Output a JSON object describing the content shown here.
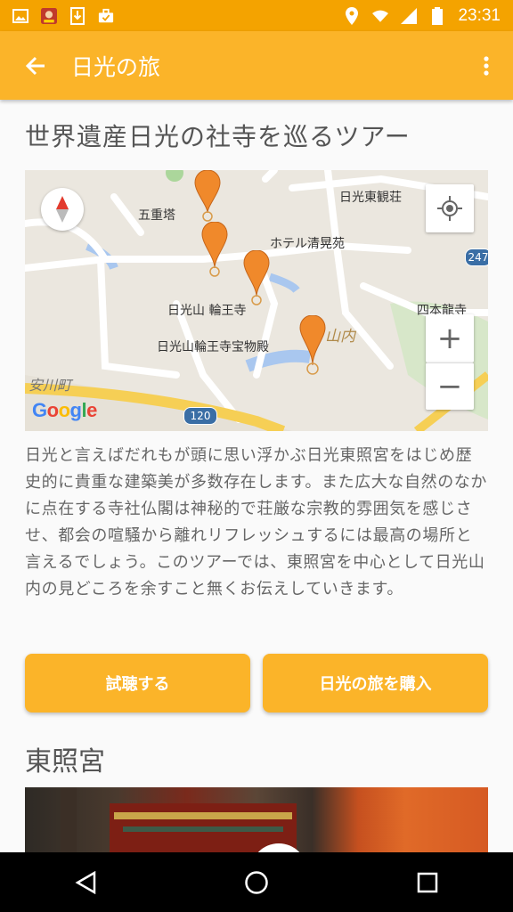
{
  "status_bar": {
    "time": "23:31",
    "left_icons": [
      "image-icon",
      "app-badge-icon",
      "download-icon",
      "briefcase-icon"
    ],
    "right_icons": [
      "location-icon",
      "wifi-icon",
      "signal-icon",
      "battery-icon"
    ]
  },
  "app_bar": {
    "title": "日光の旅"
  },
  "tour": {
    "title": "世界遺産日光の社寺を巡るツアー",
    "description": "日光と言えばだれもが頭に思い浮かぶ日光東照宮をはじめ歴史的に貴重な建築美が多数存在します。また広大な自然のなかに点在する寺社仏閣は神秘的で荘厳な宗教的雰囲気を感じさせ、都会の喧騒から離れリフレッシュするには最高の場所と言えるでしょう。このツアーでは、東照宮を中心として日光山内の見どころを余すこと無くお伝えしていきます。"
  },
  "map": {
    "labels": {
      "gojunoto": "五重塔",
      "toshogu_kan": "日光東観荘",
      "hotel": "ホテル清晃苑",
      "rinnoji": "日光山 輪王寺",
      "shihonryuji": "四本龍寺",
      "homotsuden": "日光山輪王寺宝物殿",
      "sannai": "山内",
      "yasukawa": "安川町",
      "route": "120",
      "route2": "247"
    },
    "google": "Google",
    "zoom_in": "+",
    "zoom_out": "−"
  },
  "actions": {
    "listen": "試聴する",
    "buy": "日光の旅を購入"
  },
  "section": {
    "title": "東照宮"
  },
  "colors": {
    "status_bar": "#f4a300",
    "app_bar": "#fbb429",
    "button": "#fbb429",
    "marker": "#f0892b"
  }
}
